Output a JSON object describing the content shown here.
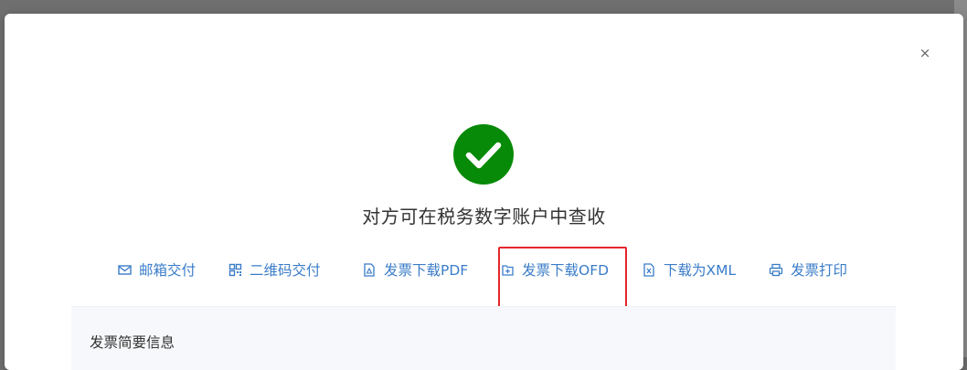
{
  "modal": {
    "close_glyph": "×",
    "message": "对方可在税务数字账户中查收",
    "success_color": "#078a07"
  },
  "actions": [
    {
      "label": "邮箱交付",
      "icon": "mail-icon"
    },
    {
      "label": "二维码交付",
      "icon": "qr-code-icon"
    },
    {
      "label": "发票下载PDF",
      "icon": "pdf-file-icon"
    },
    {
      "label": "发票下载OFD",
      "icon": "ofd-file-icon"
    },
    {
      "label": "下载为XML",
      "icon": "xml-file-icon"
    },
    {
      "label": "发票打印",
      "icon": "printer-icon"
    }
  ],
  "summary": {
    "title": "发票简要信息"
  },
  "colors": {
    "link": "#3a7cc9",
    "highlight": "#e4262b",
    "overlay": "#6f6f6f"
  }
}
